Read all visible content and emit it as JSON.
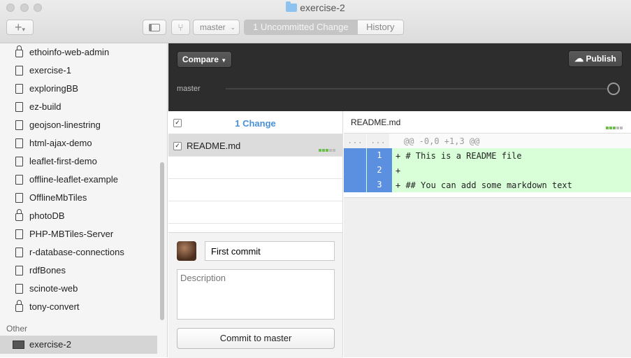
{
  "window": {
    "title": "exercise-2"
  },
  "toolbar": {
    "add_label": "+",
    "branch_select": "master",
    "uncommitted_tab": "1 Uncommitted Change",
    "history_tab": "History"
  },
  "sidebar": {
    "repos": [
      {
        "name": "ethoinfo-web-admin",
        "icon": "lock-icon"
      },
      {
        "name": "exercise-1",
        "icon": "repo-icon"
      },
      {
        "name": "exploringBB",
        "icon": "repo-icon"
      },
      {
        "name": "ez-build",
        "icon": "repo-icon"
      },
      {
        "name": "geojson-linestring",
        "icon": "repo-icon"
      },
      {
        "name": "html-ajax-demo",
        "icon": "repo-icon"
      },
      {
        "name": "leaflet-first-demo",
        "icon": "repo-icon"
      },
      {
        "name": "offline-leaflet-example",
        "icon": "repo-icon"
      },
      {
        "name": "OfflineMbTiles",
        "icon": "repo-icon"
      },
      {
        "name": "photoDB",
        "icon": "lock-icon"
      },
      {
        "name": "PHP-MBTiles-Server",
        "icon": "repo-icon"
      },
      {
        "name": "r-database-connections",
        "icon": "repo-icon"
      },
      {
        "name": "rdfBones",
        "icon": "repo-icon"
      },
      {
        "name": "scinote-web",
        "icon": "repo-icon"
      },
      {
        "name": "tony-convert",
        "icon": "lock-icon"
      }
    ],
    "other_header": "Other",
    "other_repos": [
      {
        "name": "exercise-2",
        "icon": "computer-icon",
        "selected": true
      }
    ]
  },
  "header": {
    "compare_label": "Compare",
    "publish_label": "Publish",
    "branch_label": "master"
  },
  "changes": {
    "count_label": "1 Change",
    "files": [
      {
        "name": "README.md",
        "checked": true
      }
    ]
  },
  "commit": {
    "summary_value": "First commit",
    "description_placeholder": "Description",
    "button_label": "Commit to master"
  },
  "diff": {
    "filename": "README.md",
    "hunk_old": "...",
    "hunk_new": "...",
    "hunk_header": "@@ -0,0 +1,3 @@",
    "lines": [
      {
        "num": "1",
        "text": "+ # This is a README file"
      },
      {
        "num": "2",
        "text": "+"
      },
      {
        "num": "3",
        "text": "+ ## You can add some markdown text"
      }
    ]
  },
  "colors": {
    "accent": "#4a90d9",
    "added_bg": "#d9ffd9",
    "gutter_added": "#5b8fe0"
  }
}
